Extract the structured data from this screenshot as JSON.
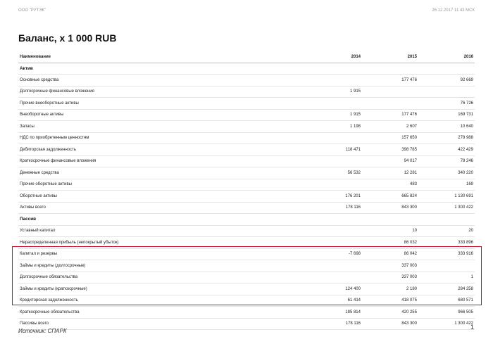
{
  "header": {
    "company": "ООО \"РУТЭК\"",
    "timestamp": "25.12.2017 11:43 МСК"
  },
  "title": "Баланс, х 1 000 RUB",
  "table": {
    "columns": [
      "Наименование",
      "2014",
      "2015",
      "2016"
    ],
    "rows": [
      {
        "section": true,
        "label": "Актив",
        "v2014": "",
        "v2015": "",
        "v2016": ""
      },
      {
        "label": "Основные средства",
        "v2014": "",
        "v2015": "177 476",
        "v2016": "92 669"
      },
      {
        "label": "Долгосрочные финансовые вложения",
        "v2014": "1 915",
        "v2015": "",
        "v2016": ""
      },
      {
        "label": "Прочие внеоборотные активы",
        "v2014": "",
        "v2015": "",
        "v2016": "76 726"
      },
      {
        "label": "Внеоборотные активы",
        "v2014": "1 915",
        "v2015": "177 476",
        "v2016": "169 731"
      },
      {
        "label": "Запасы",
        "v2014": "1 198",
        "v2015": "2 607",
        "v2016": "10 640"
      },
      {
        "label": "НДС по приобретенным ценностям",
        "v2014": "",
        "v2015": "157 650",
        "v2016": "278 988"
      },
      {
        "label": "Дебиторская задолженность",
        "v2014": "118 471",
        "v2015": "398 785",
        "v2016": "422 429"
      },
      {
        "label": "Краткосрочные финансовые вложения",
        "v2014": "",
        "v2015": "94 017",
        "v2016": "78 246"
      },
      {
        "label": "Денежные средства",
        "v2014": "56 532",
        "v2015": "12 281",
        "v2016": "340 220"
      },
      {
        "label": "Прочие оборотные активы",
        "v2014": "",
        "v2015": "483",
        "v2016": "169"
      },
      {
        "label": "Оборотные активы",
        "v2014": "176 201",
        "v2015": "665 824",
        "v2016": "1 130 691"
      },
      {
        "label": "Активы всего",
        "v2014": "178 116",
        "v2015": "843 300",
        "v2016": "1 300 422"
      },
      {
        "section": true,
        "label": "Пассив",
        "v2014": "",
        "v2015": "",
        "v2016": ""
      },
      {
        "label": "Уставный капитал",
        "v2014": "",
        "v2015": "10",
        "v2016": "20"
      },
      {
        "label": "Нераспределенная прибыль (непокрытый убыток)",
        "v2014": "",
        "v2015": "86 032",
        "v2016": "333 896"
      },
      {
        "label": "Капитал и резервы",
        "v2014": "-7 698",
        "v2015": "86 042",
        "v2016": "333 916"
      },
      {
        "label": "Займы и кредиты (долгосрочные)",
        "v2014": "",
        "v2015": "337 003",
        "v2016": ""
      },
      {
        "label": "Долгосрочные обязательства",
        "v2014": "",
        "v2015": "337 003",
        "v2016": "1"
      },
      {
        "label": "Займы и кредиты (краткосрочные)",
        "v2014": "124 400",
        "v2015": "2 180",
        "v2016": "284 258"
      },
      {
        "label": "Кредиторская задолженность",
        "v2014": "61 414",
        "v2015": "418 075",
        "v2016": "680 571"
      },
      {
        "label": "Краткосрочные обязательства",
        "v2014": "185 814",
        "v2015": "420 255",
        "v2016": "966 505"
      },
      {
        "label": "Пассивы всего",
        "v2014": "178 116",
        "v2015": "843 300",
        "v2016": "1 300 422"
      }
    ]
  },
  "highlight_color": "#c8102e",
  "footer": {
    "source": "Источник: СПАРК",
    "page": "1"
  }
}
